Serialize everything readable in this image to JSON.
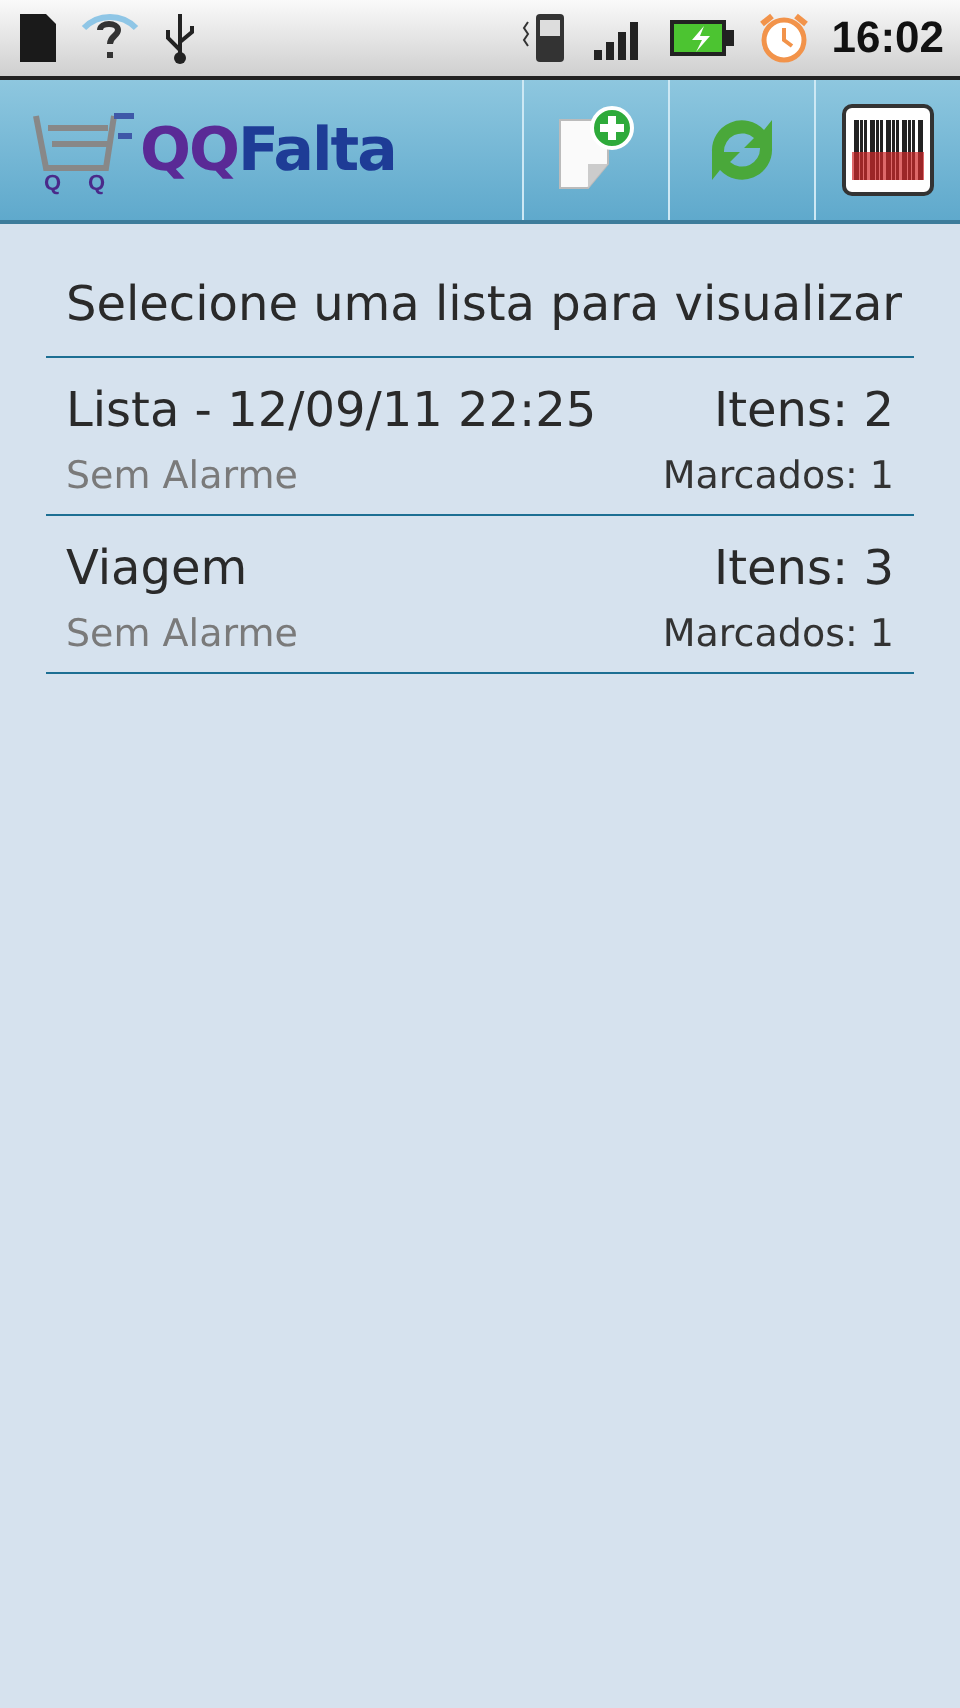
{
  "status_bar": {
    "time": "16:02"
  },
  "app_bar": {
    "logo": {
      "first": "QQ",
      "second": "Falta",
      "wheels": [
        "Q",
        "Q"
      ]
    }
  },
  "heading": "Selecione uma lista para visualizar",
  "lists": [
    {
      "name": "Lista - 12/09/11 22:25",
      "items": "Itens: 2",
      "alarm": "Sem Alarme",
      "marked": "Marcados: 1"
    },
    {
      "name": "Viagem",
      "items": "Itens: 3",
      "alarm": "Sem Alarme",
      "marked": "Marcados: 1"
    }
  ]
}
